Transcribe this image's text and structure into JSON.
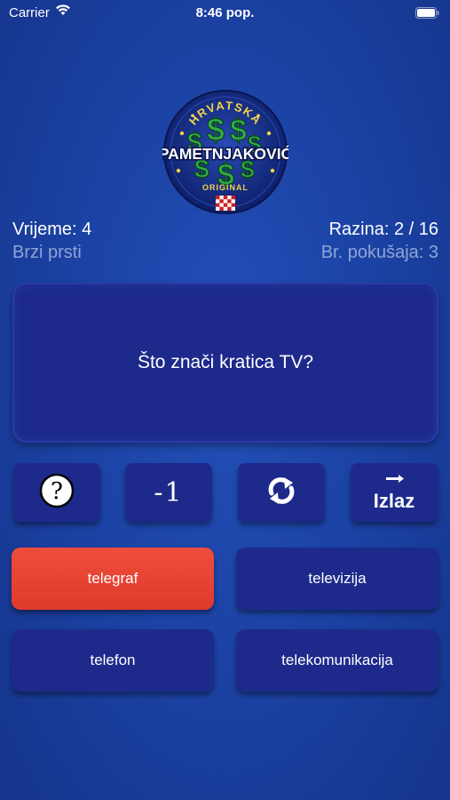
{
  "status_bar": {
    "carrier": "Carrier",
    "time": "8:46 pop."
  },
  "logo": {
    "top_text": "HRVATSKA",
    "main_text": "PAMETNJAKOVIĆ",
    "bottom_text": "ORIGINAL"
  },
  "game_info": {
    "time_label": "Vrijeme: 4",
    "mode_label": "Brzi prsti",
    "level_label": "Razina: 2 / 16",
    "attempts_label": "Br. pokušaja: 3"
  },
  "question": {
    "text": "Što znači kratica TV?"
  },
  "jokers": {
    "help_icon": "question-mark-icon",
    "minus_one_label": "-1",
    "swap_icon": "swap-arrows-icon",
    "exit_label": "Izlaz"
  },
  "answers": [
    {
      "text": "telegraf",
      "state": "selected-wrong",
      "color": "#e8432f"
    },
    {
      "text": "televizija",
      "state": "default",
      "color": "#1d2a8c"
    },
    {
      "text": "telefon",
      "state": "default",
      "color": "#1d2a8c"
    },
    {
      "text": "telekomunikacija",
      "state": "default",
      "color": "#1d2a8c"
    }
  ],
  "colors": {
    "background": "#1c43a6",
    "button": "#1d2a8c",
    "wrong_answer": "#e8432f",
    "secondary_text": "#8ea6d6"
  }
}
